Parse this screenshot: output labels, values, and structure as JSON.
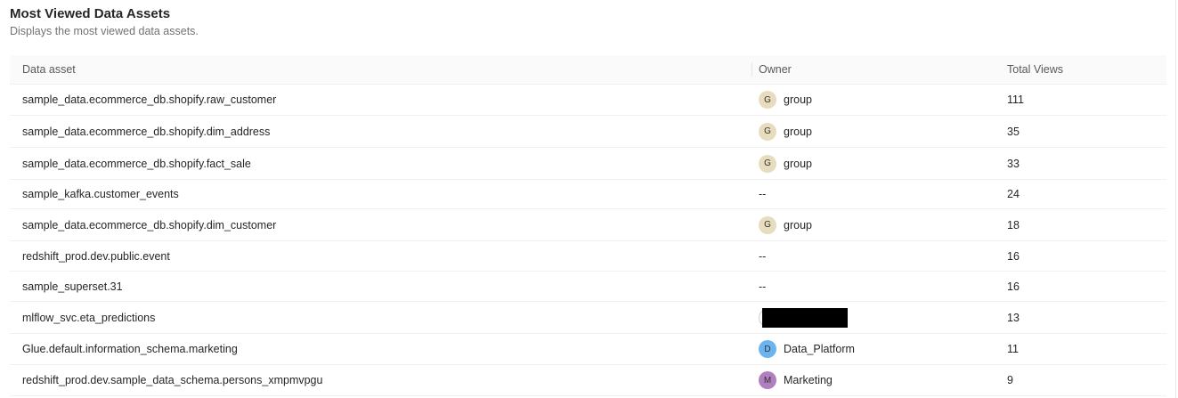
{
  "header": {
    "title": "Most Viewed Data Assets",
    "subtitle": "Displays the most viewed data assets."
  },
  "table": {
    "columns": [
      "Data asset",
      "Owner",
      "Total Views"
    ],
    "rows": [
      {
        "asset": "sample_data.ecommerce_db.shopify.raw_customer",
        "owner": "group",
        "owner_initial": "G",
        "avatar_color": "#e8dcbf",
        "views": "111"
      },
      {
        "asset": "sample_data.ecommerce_db.shopify.dim_address",
        "owner": "group",
        "owner_initial": "G",
        "avatar_color": "#e8dcbf",
        "views": "35"
      },
      {
        "asset": "sample_data.ecommerce_db.shopify.fact_sale",
        "owner": "group",
        "owner_initial": "G",
        "avatar_color": "#e8dcbf",
        "views": "33"
      },
      {
        "asset": "sample_kafka.customer_events",
        "owner": "--",
        "views": "24"
      },
      {
        "asset": "sample_data.ecommerce_db.shopify.dim_customer",
        "owner": "group",
        "owner_initial": "G",
        "avatar_color": "#e8dcbf",
        "views": "18"
      },
      {
        "asset": "redshift_prod.dev.public.event",
        "owner": "--",
        "views": "16"
      },
      {
        "asset": "sample_superset.31",
        "owner": "--",
        "views": "16"
      },
      {
        "asset": "mlflow_svc.eta_predictions",
        "owner_redacted": true,
        "views": "13"
      },
      {
        "asset": "Glue.default.information_schema.marketing",
        "owner": "Data_Platform",
        "owner_initial": "D",
        "avatar_color": "#6cb4ee",
        "views": "11"
      },
      {
        "asset": "redshift_prod.dev.sample_data_schema.persons_xmpmvpgu",
        "owner": "Marketing",
        "owner_initial": "M",
        "avatar_color": "#b07fbf",
        "views": "9"
      }
    ]
  }
}
